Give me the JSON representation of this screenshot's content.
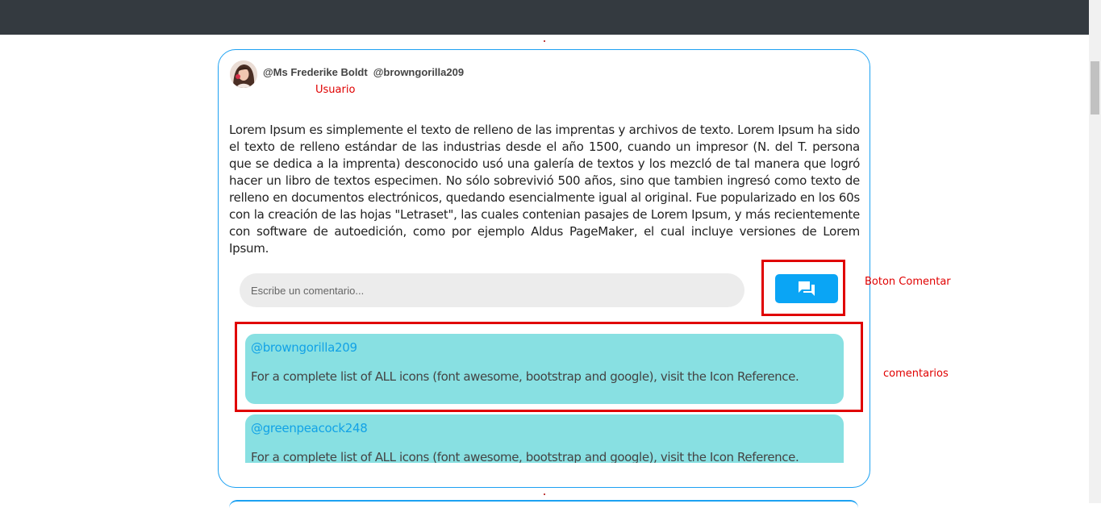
{
  "post": {
    "author_name": "@Ms Frederike Boldt",
    "author_handle": "@browngorilla209",
    "body": "Lorem Ipsum es simplemente el texto de relleno de las imprentas y archivos de texto. Lorem Ipsum ha sido el texto de relleno estándar de las industrias desde el año 1500, cuando un impresor (N. del T. persona que se dedica a la imprenta) desconocido usó una galería de textos y los mezcló de tal manera que logró hacer un libro de textos especimen. No sólo sobrevivió 500 años, sino que tambien ingresó como texto de relleno en documentos electrónicos, quedando esencialmente igual al original. Fue popularizado en los 60s con la creación de las hojas \"Letraset\", las cuales contenian pasajes de Lorem Ipsum, y más recientemente con software de autoedición, como por ejemplo Aldus PageMaker, el cual incluye versiones de Lorem Ipsum."
  },
  "comment_form": {
    "placeholder": "Escribe un comentario...",
    "button_icon": "comment-icon"
  },
  "comments": [
    {
      "handle": "@browngorilla209",
      "text": "For a complete list of ALL icons (font awesome, bootstrap and google), visit the Icon Reference."
    },
    {
      "handle": "@greenpeacock248",
      "text": "For a complete list of ALL icons (font awesome, bootstrap and google), visit the Icon Reference."
    }
  ],
  "annotations": {
    "user": "Usuario",
    "comment_button": "Boton Comentar",
    "comments": "comentarios"
  },
  "colors": {
    "accent": "#1da1f2",
    "button": "#0aa5f5",
    "comment_bg": "#88e0e2",
    "annotation": "#e00000",
    "topbar": "#343a40"
  }
}
